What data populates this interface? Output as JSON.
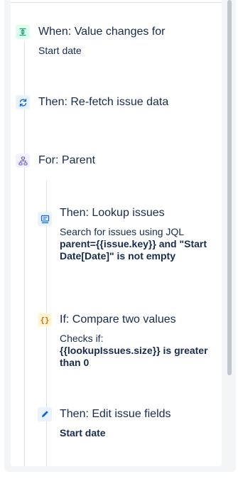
{
  "steps": [
    {
      "title": "When: Value changes for",
      "detail": "Start date",
      "icon": "trigger-icon",
      "icon_bg": "#dcfff1",
      "icon_color": "#22a06b"
    },
    {
      "title": "Then: Re-fetch issue data",
      "icon": "refresh-icon",
      "icon_bg": "#e9f2ff",
      "icon_color": "#0c66e4"
    },
    {
      "title": "For: Parent",
      "icon": "hierarchy-icon",
      "icon_bg": "#f3f0ff",
      "icon_color": "#6e5dc6"
    },
    {
      "title": "Then: Lookup issues",
      "line1": "Search for issues using JQL",
      "bold": "parent={{issue.key}} and \"Start Date[Date]\" is not empty",
      "icon": "lookup-monitor-icon",
      "icon_bg": "#e9f2ff",
      "icon_color": "#0c66e4"
    },
    {
      "title": "If: Compare two values",
      "line1": "Checks if:",
      "bold": "{{lookupIssues.size}} is greater than 0",
      "icon": "braces-icon",
      "icon_bg": "#fff7d6",
      "icon_color": "#e56910"
    },
    {
      "title": "Then: Edit issue fields",
      "bold": "Start date",
      "icon": "pencil-icon",
      "icon_bg": "#e9f2ff",
      "icon_color": "#0c66e4"
    }
  ]
}
